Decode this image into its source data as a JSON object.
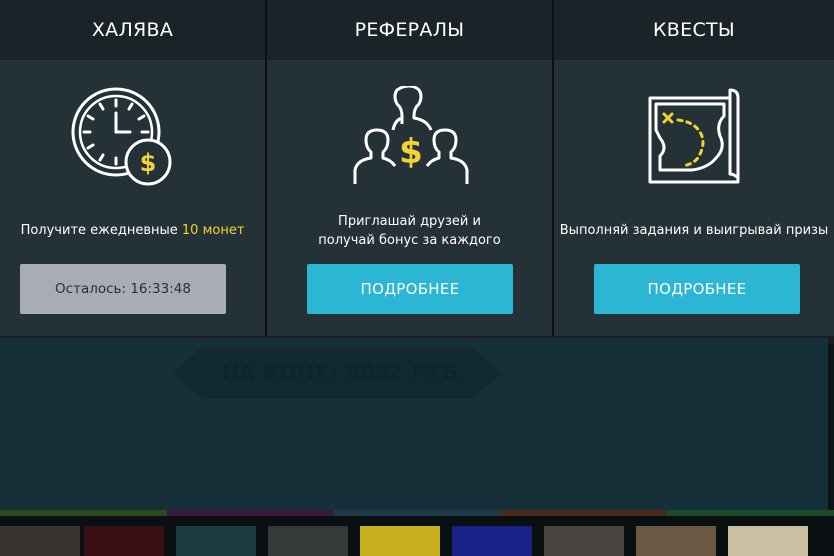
{
  "panels": [
    {
      "title": "ХАЛЯВА",
      "icon": "clock-coin-icon",
      "desc_prefix": "Получите ежедневные ",
      "desc_highlight": "10 монет",
      "button": "Осталось: 16:33:48"
    },
    {
      "title": "РЕФЕРАЛЫ",
      "icon": "referral-people-icon",
      "desc_line1": "Приглашай друзей и",
      "desc_line2": "получай бонус за каждого",
      "button": "ПОДРОБНЕЕ"
    },
    {
      "title": "КВЕСТЫ",
      "icon": "treasure-map-icon",
      "desc": "Выполняй задания и выигрывай призы",
      "button": "ПОДРОБНЕЕ"
    }
  ],
  "background": {
    "pot_label": "НА КОНУ:  9082 РУБ."
  },
  "colors": {
    "panel_bg": "#243137",
    "header_bg": "#1a2327",
    "accent_yellow": "#f2d333",
    "button_blue": "#2bb6d3",
    "button_gray": "#a7acb7"
  }
}
